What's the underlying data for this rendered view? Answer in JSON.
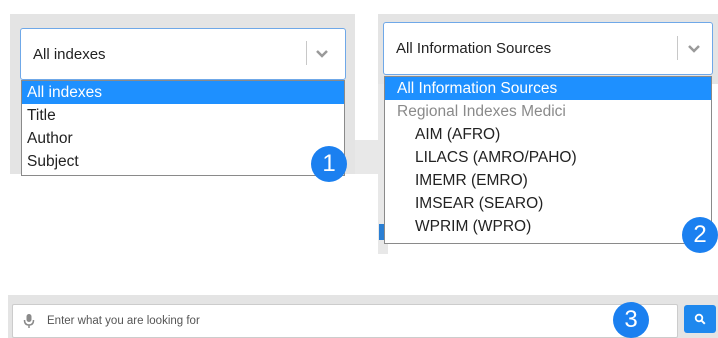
{
  "panel1": {
    "select_value": "All indexes",
    "options": [
      {
        "label": "All indexes",
        "selected": true
      },
      {
        "label": "Title",
        "selected": false
      },
      {
        "label": "Author",
        "selected": false
      },
      {
        "label": "Subject",
        "selected": false
      }
    ],
    "badge": "1"
  },
  "panel2": {
    "select_value": "All Information Sources",
    "options": [
      {
        "label": "All Information Sources",
        "selected": true,
        "group": false
      },
      {
        "label": "Regional Indexes Medici",
        "selected": false,
        "group": true
      },
      {
        "label": "AIM (AFRO)",
        "selected": false,
        "group": false
      },
      {
        "label": "LILACS (AMRO/PAHO)",
        "selected": false,
        "group": false
      },
      {
        "label": "IMEMR (EMRO)",
        "selected": false,
        "group": false
      },
      {
        "label": "IMSEAR (SEARO)",
        "selected": false,
        "group": false
      },
      {
        "label": "WPRIM (WPRO)",
        "selected": false,
        "group": false
      }
    ],
    "badge": "2"
  },
  "search": {
    "placeholder": "Enter what you are looking for",
    "badge": "3",
    "icons": {
      "mic": "microphone-icon",
      "search": "search-icon"
    }
  },
  "colors": {
    "accent": "#1e90ff",
    "badge": "#1b80f0",
    "border": "#6fa8e8",
    "panel_bg": "#e4e4e4"
  }
}
